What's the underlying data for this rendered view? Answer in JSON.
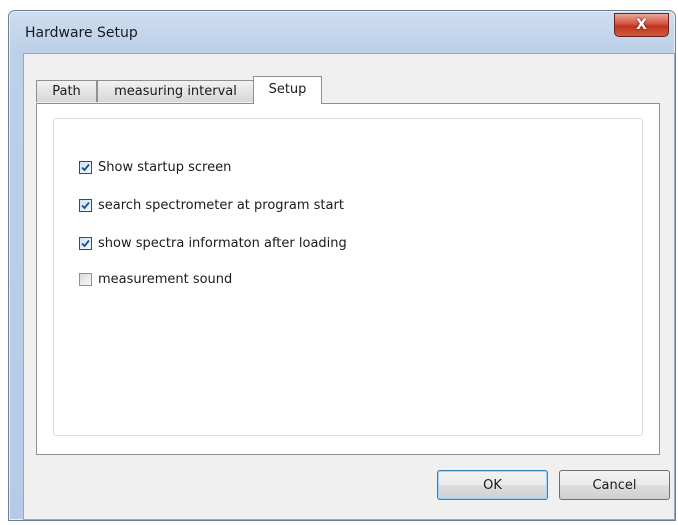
{
  "window": {
    "title": "Hardware Setup",
    "close_label": "X"
  },
  "tabs": [
    {
      "label": "Path"
    },
    {
      "label": "measuring interval"
    },
    {
      "label": "Setup",
      "active": true
    }
  ],
  "options": [
    {
      "label": "Show startup screen",
      "checked": true
    },
    {
      "label": "search spectrometer at program start",
      "checked": true
    },
    {
      "label": "show spectra informaton after loading",
      "checked": true
    },
    {
      "label": "measurement sound",
      "checked": false
    }
  ],
  "buttons": {
    "ok_label": "OK",
    "cancel_label": "Cancel"
  },
  "colors": {
    "checkmark": "#1c4f8a",
    "default_button_border": "#3c7fb1"
  },
  "icons": {
    "close": "close-icon",
    "check": "checkmark-icon"
  }
}
